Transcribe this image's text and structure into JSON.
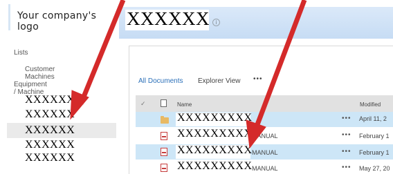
{
  "logo": {
    "text": "Your company's logo"
  },
  "site": {
    "title": "XXXXXX",
    "info_icon": "info-icon",
    "info_glyph": "i"
  },
  "nav": {
    "lists_heading": "Lists",
    "customer_machines": "Customer Machines",
    "equipment_heading": "Equipment / Machine",
    "items": [
      "XXXXXX",
      "XXXXXX",
      "XXXXXX",
      "XXXXXX",
      "XXXXXX"
    ],
    "selected_index": 2
  },
  "views": {
    "all_documents": "All Documents",
    "explorer_view": "Explorer View",
    "more": "•••"
  },
  "table": {
    "check_glyph": "✓",
    "columns": {
      "name": "Name",
      "modified": "Modified"
    },
    "rows": [
      {
        "icon": "folder-icon",
        "name": "XXXXXXXXX",
        "suffix": "",
        "dots": "•••",
        "modified": "April 11, 2",
        "selected": true
      },
      {
        "icon": "pdf-icon",
        "name": "XXXXXXXXX",
        "suffix": "MANUAL",
        "dots": "•••",
        "modified": "February 1",
        "selected": false
      },
      {
        "icon": "pdf-icon",
        "name": "XXXXXXXXX",
        "suffix": "MANUAL",
        "dots": "•••",
        "modified": "February 1",
        "selected": true
      },
      {
        "icon": "pdf-icon",
        "name": "XXXXXXXXX",
        "suffix": "MANUAL",
        "dots": "•••",
        "modified": "May 27, 20",
        "selected": false
      }
    ]
  },
  "colors": {
    "annotation_arrow": "#d42a2a",
    "accent": "#2a6fb8",
    "selected_row": "#cde6f7"
  }
}
